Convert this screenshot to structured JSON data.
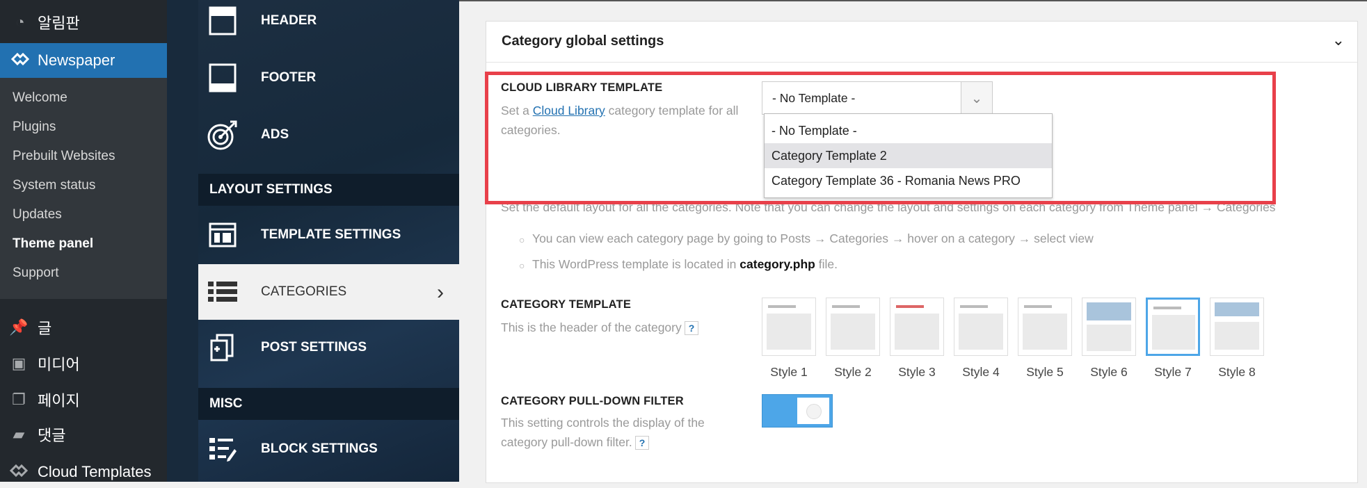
{
  "wp_sidebar": {
    "dashboard_label": "알림판",
    "newspaper_label": "Newspaper",
    "submenu": [
      "Welcome",
      "Plugins",
      "Prebuilt Websites",
      "System status",
      "Updates",
      "Theme panel",
      "Support"
    ],
    "posts_label": "글",
    "media_label": "미디어",
    "pages_label": "페이지",
    "comments_label": "댓글",
    "cloud_templates_label": "Cloud Templates"
  },
  "panel_nav": {
    "header": "HEADER",
    "footer": "FOOTER",
    "ads": "ADS",
    "layout_section": "LAYOUT SETTINGS",
    "template_settings": "TEMPLATE SETTINGS",
    "categories": "CATEGORIES",
    "post_settings": "POST SETTINGS",
    "misc_section": "MISC",
    "block_settings": "BLOCK SETTINGS"
  },
  "card": {
    "title": "Category global settings",
    "cloud_library": {
      "title": "CLOUD LIBRARY TEMPLATE",
      "desc_prefix": "Set a ",
      "desc_link": "Cloud Library",
      "desc_suffix": " category template for all categories.",
      "selected": "- No Template -",
      "options": [
        "- No Template -",
        "Category Template 2",
        "Category Template 36 - Romania News PRO"
      ],
      "highlighted_option": "Category Template 2"
    },
    "layout_note": "Set the default layout for all the categories. Note that you can change the layout and settings on each category from Theme panel → Categories",
    "note1": "You can view each category page by going to Posts → Categories → hover on a category → select view",
    "note2_prefix": "This WordPress template is located in ",
    "note2_file": "category.php",
    "note2_suffix": " file.",
    "category_template": {
      "title": "CATEGORY TEMPLATE",
      "desc": "This is the header of the category",
      "help": "?",
      "styles": [
        "Style 1",
        "Style 2",
        "Style 3",
        "Style 4",
        "Style 5",
        "Style 6",
        "Style 7",
        "Style 8"
      ],
      "selected_style": "Style 7"
    },
    "pulldown_filter": {
      "title": "CATEGORY PULL-DOWN FILTER",
      "desc": "This setting controls the display of the category pull-down filter.",
      "help": "?",
      "enabled": true
    }
  },
  "colors": {
    "wp_sidebar_bg": "#23282d",
    "wp_active_blue": "#2271b1",
    "highlight_red": "#e8404a",
    "toggle_blue": "#4da6e8"
  }
}
